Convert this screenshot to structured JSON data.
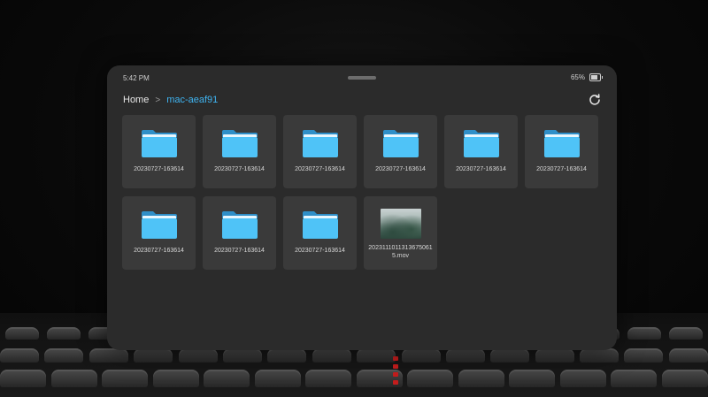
{
  "status_bar": {
    "time": "5:42 PM",
    "battery_percent": "65%",
    "battery_level": 0.65
  },
  "breadcrumb": {
    "home": "Home",
    "separator": ">",
    "current": "mac-aeaf91"
  },
  "toolbar": {
    "refresh_icon": "refresh-icon"
  },
  "colors": {
    "accent": "#3fb3f0",
    "folder": "#4fc3f7",
    "panel": "#2b2b2b",
    "tile": "#3a3a3a"
  },
  "items": [
    {
      "type": "folder",
      "name": "20230727-163614"
    },
    {
      "type": "folder",
      "name": "20230727-163614"
    },
    {
      "type": "folder",
      "name": "20230727-163614"
    },
    {
      "type": "folder",
      "name": "20230727-163614"
    },
    {
      "type": "folder",
      "name": "20230727-163614"
    },
    {
      "type": "folder",
      "name": "20230727-163614"
    },
    {
      "type": "folder",
      "name": "20230727-163614"
    },
    {
      "type": "folder",
      "name": "20230727-163614"
    },
    {
      "type": "folder",
      "name": "20230727-163614"
    },
    {
      "type": "video",
      "name": "20231110113136750615.mov"
    }
  ]
}
